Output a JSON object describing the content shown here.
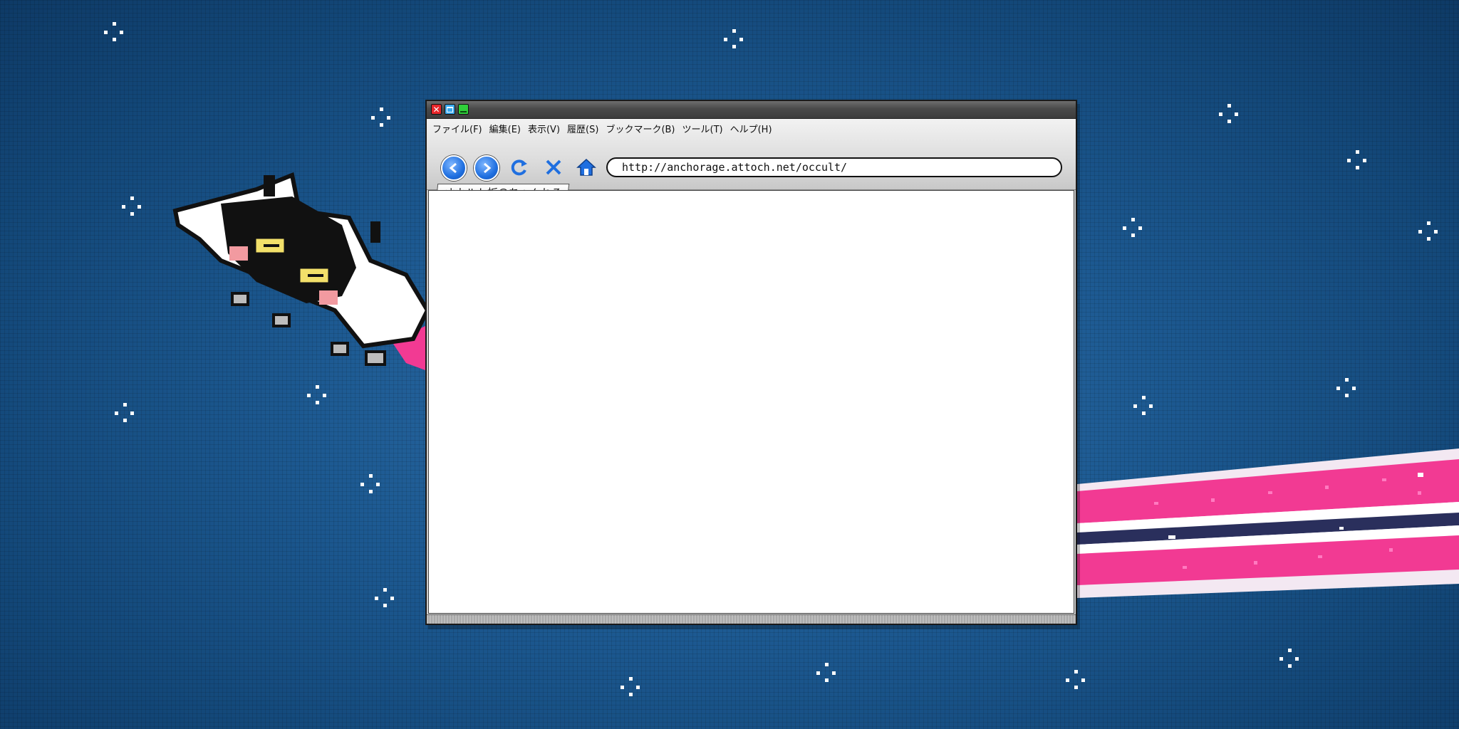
{
  "browser": {
    "window_buttons": [
      "close-icon",
      "minimize-icon",
      "maximize-icon"
    ],
    "menu": [
      "ファイル(F)",
      "編集(E)",
      "表示(V)",
      "履歴(S)",
      "ブックマーク(B)",
      "ツール(T)",
      "ヘルプ(H)"
    ],
    "url": "http://anchorage.attoch.net/occult/",
    "tab_label": "オカルト板@ちゃんねる",
    "toolbar_icons": [
      "back-icon",
      "forward-icon",
      "reload-icon",
      "stop-icon",
      "home-icon"
    ]
  },
  "colors": {
    "background": "#1d5a92",
    "trail_pink": "#f23a93",
    "nav_blue": "#1f6fe0"
  }
}
